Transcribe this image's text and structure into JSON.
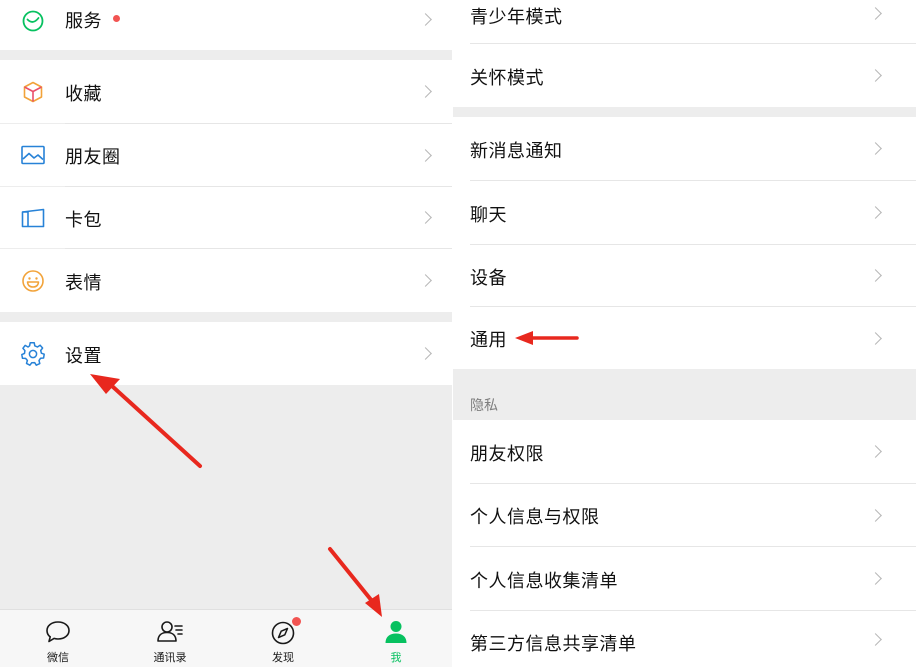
{
  "left_panel": {
    "menu": {
      "services": {
        "label": "服务",
        "icon": "services-icon"
      },
      "favorites": {
        "label": "收藏",
        "icon": "cube-icon"
      },
      "moments": {
        "label": "朋友圈",
        "icon": "image-icon"
      },
      "cards": {
        "label": "卡包",
        "icon": "wallet-icon"
      },
      "stickers": {
        "label": "表情",
        "icon": "smiley-icon"
      },
      "settings": {
        "label": "设置",
        "icon": "gear-icon"
      }
    },
    "tabbar": {
      "chats": {
        "label": "微信",
        "icon": "chat-bubble-icon"
      },
      "contacts": {
        "label": "通讯录",
        "icon": "contacts-icon"
      },
      "discover": {
        "label": "发现",
        "icon": "compass-icon"
      },
      "me": {
        "label": "我",
        "icon": "person-icon"
      }
    }
  },
  "right_panel": {
    "items": {
      "teen_mode": "青少年模式",
      "care_mode": "关怀模式",
      "notifications": "新消息通知",
      "chat": "聊天",
      "devices": "设备",
      "general": "通用"
    },
    "privacy_section": {
      "header": "隐私",
      "friend_permissions": "朋友权限",
      "personal_info_permissions": "个人信息与权限",
      "personal_info_collection": "个人信息收集清单",
      "third_party_sharing": "第三方信息共享清单"
    }
  },
  "colors": {
    "brand_green": "#07c160",
    "badge_red": "#f25452",
    "annotation_red": "#e8281e",
    "background_gray": "#ededed"
  },
  "annotations": [
    "red-arrow-to-settings",
    "red-arrow-to-me-tab",
    "red-arrow-to-general"
  ]
}
